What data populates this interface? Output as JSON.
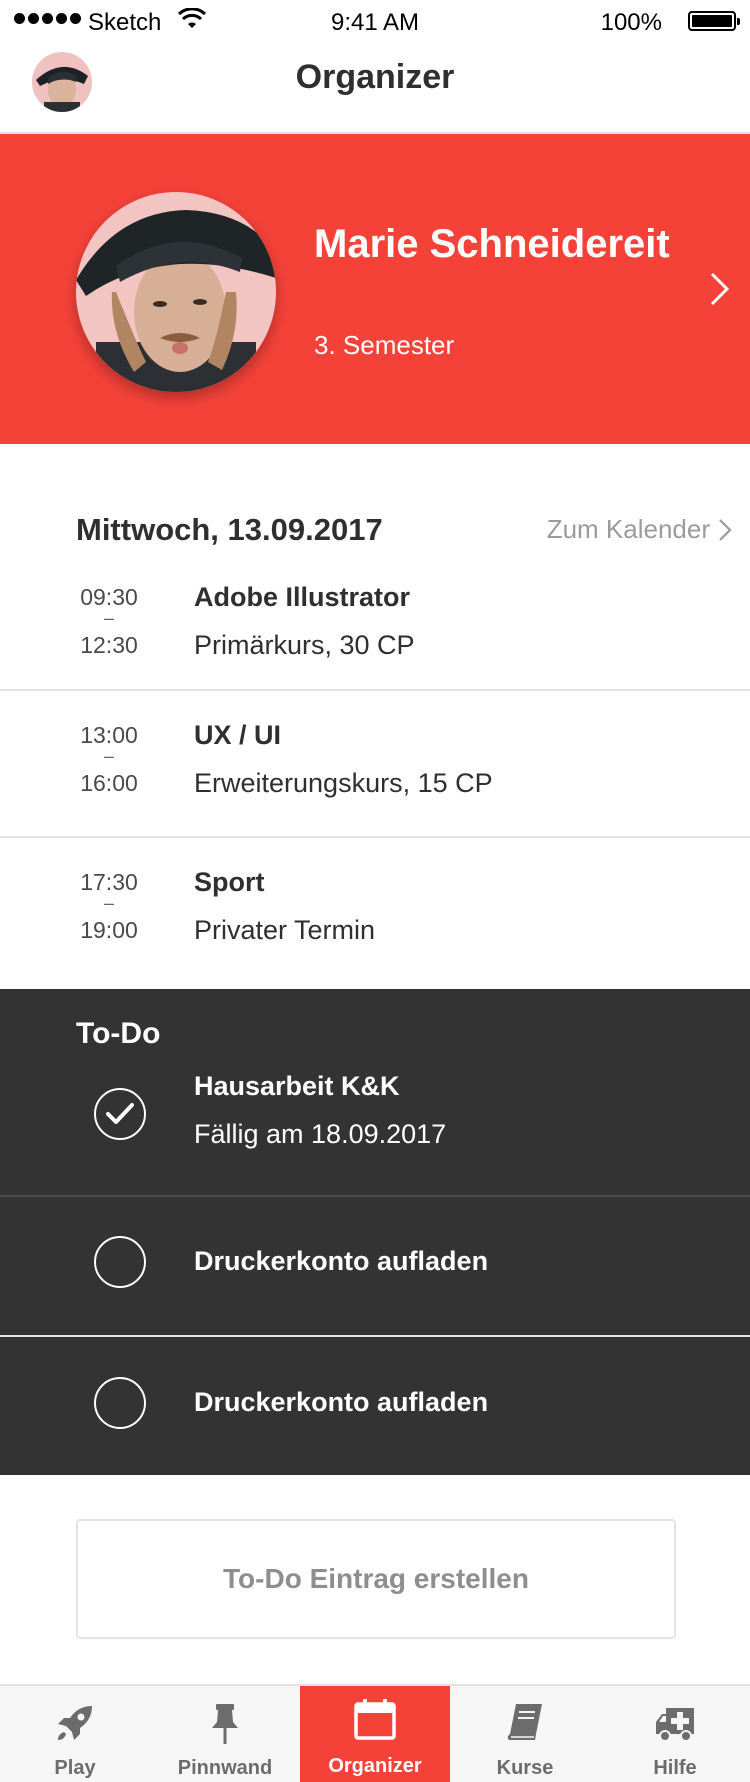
{
  "status_bar": {
    "carrier": "Sketch",
    "time": "9:41 AM",
    "battery": "100%"
  },
  "nav": {
    "title": "Organizer"
  },
  "profile": {
    "name": "Marie Schneidereit",
    "semester": "3. Semester"
  },
  "schedule": {
    "date": "Mittwoch, 13.09.2017",
    "calendar_link": "Zum Kalender",
    "events": [
      {
        "start": "09:30",
        "dash": "–",
        "end": "12:30",
        "title": "Adobe Illustrator",
        "subtitle": "Primärkurs, 30 CP"
      },
      {
        "start": "13:00",
        "dash": "–",
        "end": "16:00",
        "title": "UX / UI",
        "subtitle": "Erweiterungskurs, 15 CP"
      },
      {
        "start": "17:30",
        "dash": "–",
        "end": "19:00",
        "title": "Sport",
        "subtitle": "Privater Termin"
      }
    ]
  },
  "todo": {
    "title": "To-Do",
    "items": [
      {
        "label": "Hausarbeit K&K",
        "due": "Fällig am 18.09.2017",
        "done": true
      },
      {
        "label": "Druckerkonto aufladen",
        "done": false
      },
      {
        "label": "Druckerkonto aufladen",
        "done": false
      }
    ],
    "create_label": "To-Do Eintrag erstellen"
  },
  "tabs": [
    {
      "label": "Play",
      "icon": "rocket-icon",
      "active": false
    },
    {
      "label": "Pinnwand",
      "icon": "pushpin-icon",
      "active": false
    },
    {
      "label": "Organizer",
      "icon": "calendar-icon",
      "active": true
    },
    {
      "label": "Kurse",
      "icon": "book-icon",
      "active": false
    },
    {
      "label": "Hilfe",
      "icon": "ambulance-icon",
      "active": false
    }
  ],
  "colors": {
    "accent": "#f44239",
    "dark_panel": "#333333",
    "text": "#2f2f2f",
    "muted": "#9b9b9b"
  }
}
